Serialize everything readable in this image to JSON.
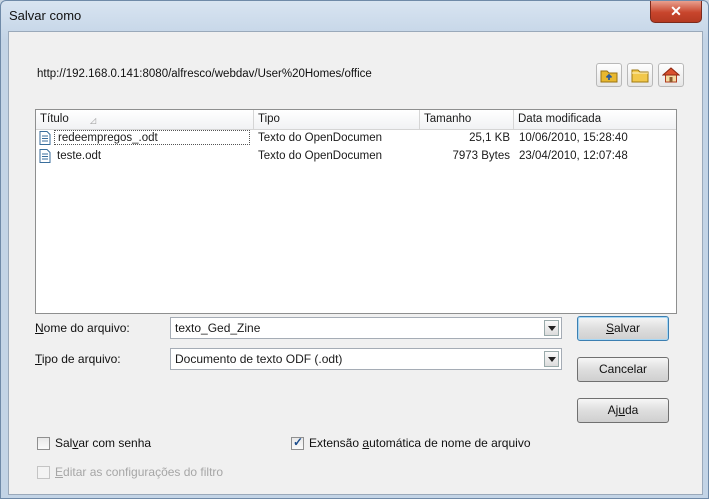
{
  "window": {
    "title": "Salvar como",
    "close_glyph": "✕"
  },
  "location": {
    "path": "http://192.168.0.141:8080/alfresco/webdav/User%20Homes/office"
  },
  "toolbar": {
    "icons": [
      "up-folder-icon",
      "new-folder-icon",
      "home-icon"
    ]
  },
  "file_list": {
    "columns": [
      "Título",
      "Tipo",
      "Tamanho",
      "Data modificada"
    ],
    "rows": [
      {
        "name": "redeempregos_.odt",
        "type": "Texto do OpenDocumen",
        "size": "25,1 KB",
        "modified": "10/06/2010, 15:28:40"
      },
      {
        "name": "teste.odt",
        "type": "Texto do OpenDocumen",
        "size": "7973 Bytes",
        "modified": "23/04/2010, 12:07:48"
      }
    ]
  },
  "filename": {
    "label_access": "N",
    "label_rest": "ome do arquivo:",
    "value": "texto_Ged_Zine"
  },
  "filetype": {
    "label_access": "T",
    "label_rest": "ipo de arquivo:",
    "value": "Documento de texto ODF (.odt)"
  },
  "buttons": {
    "save_access": "S",
    "save_rest": "alvar",
    "cancel": "Cancelar",
    "help_pre": "Aj",
    "help_access": "u",
    "help_post": "da"
  },
  "options": {
    "password_pre": "Sal",
    "password_access": "v",
    "password_post": "ar com senha",
    "password_checked": false,
    "auto_ext_pre": "Extensão ",
    "auto_ext_access": "a",
    "auto_ext_post": "utomática de nome de arquivo",
    "auto_ext_checked": true,
    "filter_access": "E",
    "filter_rest": "ditar as configurações do filtro",
    "filter_enabled": false
  },
  "colors": {
    "accent": "#3c7fb1",
    "close": "#c8452c"
  }
}
